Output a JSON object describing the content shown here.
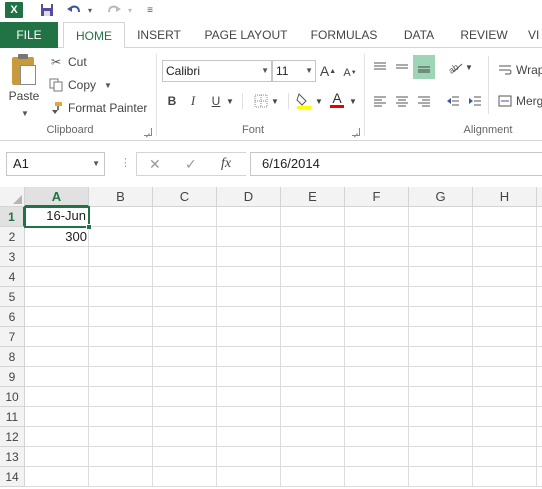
{
  "quick_access": {
    "app_icon": "excel-logo-icon",
    "app_letter": "X",
    "buttons": [
      "save-icon",
      "undo-icon",
      "redo-icon",
      "customize-icon"
    ]
  },
  "tabs": [
    {
      "label": "FILE"
    },
    {
      "label": "HOME"
    },
    {
      "label": "INSERT"
    },
    {
      "label": "PAGE LAYOUT"
    },
    {
      "label": "FORMULAS"
    },
    {
      "label": "DATA"
    },
    {
      "label": "REVIEW"
    },
    {
      "label": "VI"
    }
  ],
  "ribbon": {
    "clipboard": {
      "group_label": "Clipboard",
      "paste_label": "Paste",
      "cut_label": "Cut",
      "copy_label": "Copy",
      "format_painter_label": "Format Painter"
    },
    "font": {
      "group_label": "Font",
      "font_name": "Calibri",
      "font_size": "11",
      "bold": "B",
      "italic": "I",
      "underline": "U",
      "grow": "A",
      "shrink": "A",
      "font_color_letter": "A"
    },
    "alignment": {
      "group_label": "Alignment",
      "wrap_label": "Wrap",
      "merge_label": "Merg"
    }
  },
  "formula_bar": {
    "name_box": "A1",
    "fx_label": "fx",
    "value": "6/16/2014"
  },
  "sheet": {
    "columns": [
      "A",
      "B",
      "C",
      "D",
      "E",
      "F",
      "G",
      "H"
    ],
    "rows": [
      "1",
      "2",
      "3",
      "4",
      "5",
      "6",
      "7",
      "8",
      "9",
      "10",
      "11",
      "12",
      "13",
      "14"
    ],
    "active_cell": "A1",
    "cells": {
      "A1": "16-Jun",
      "A2": "300"
    }
  },
  "colors": {
    "accent": "#217346",
    "header_bg": "#f3f3f3",
    "gridline": "#dadcdd"
  }
}
